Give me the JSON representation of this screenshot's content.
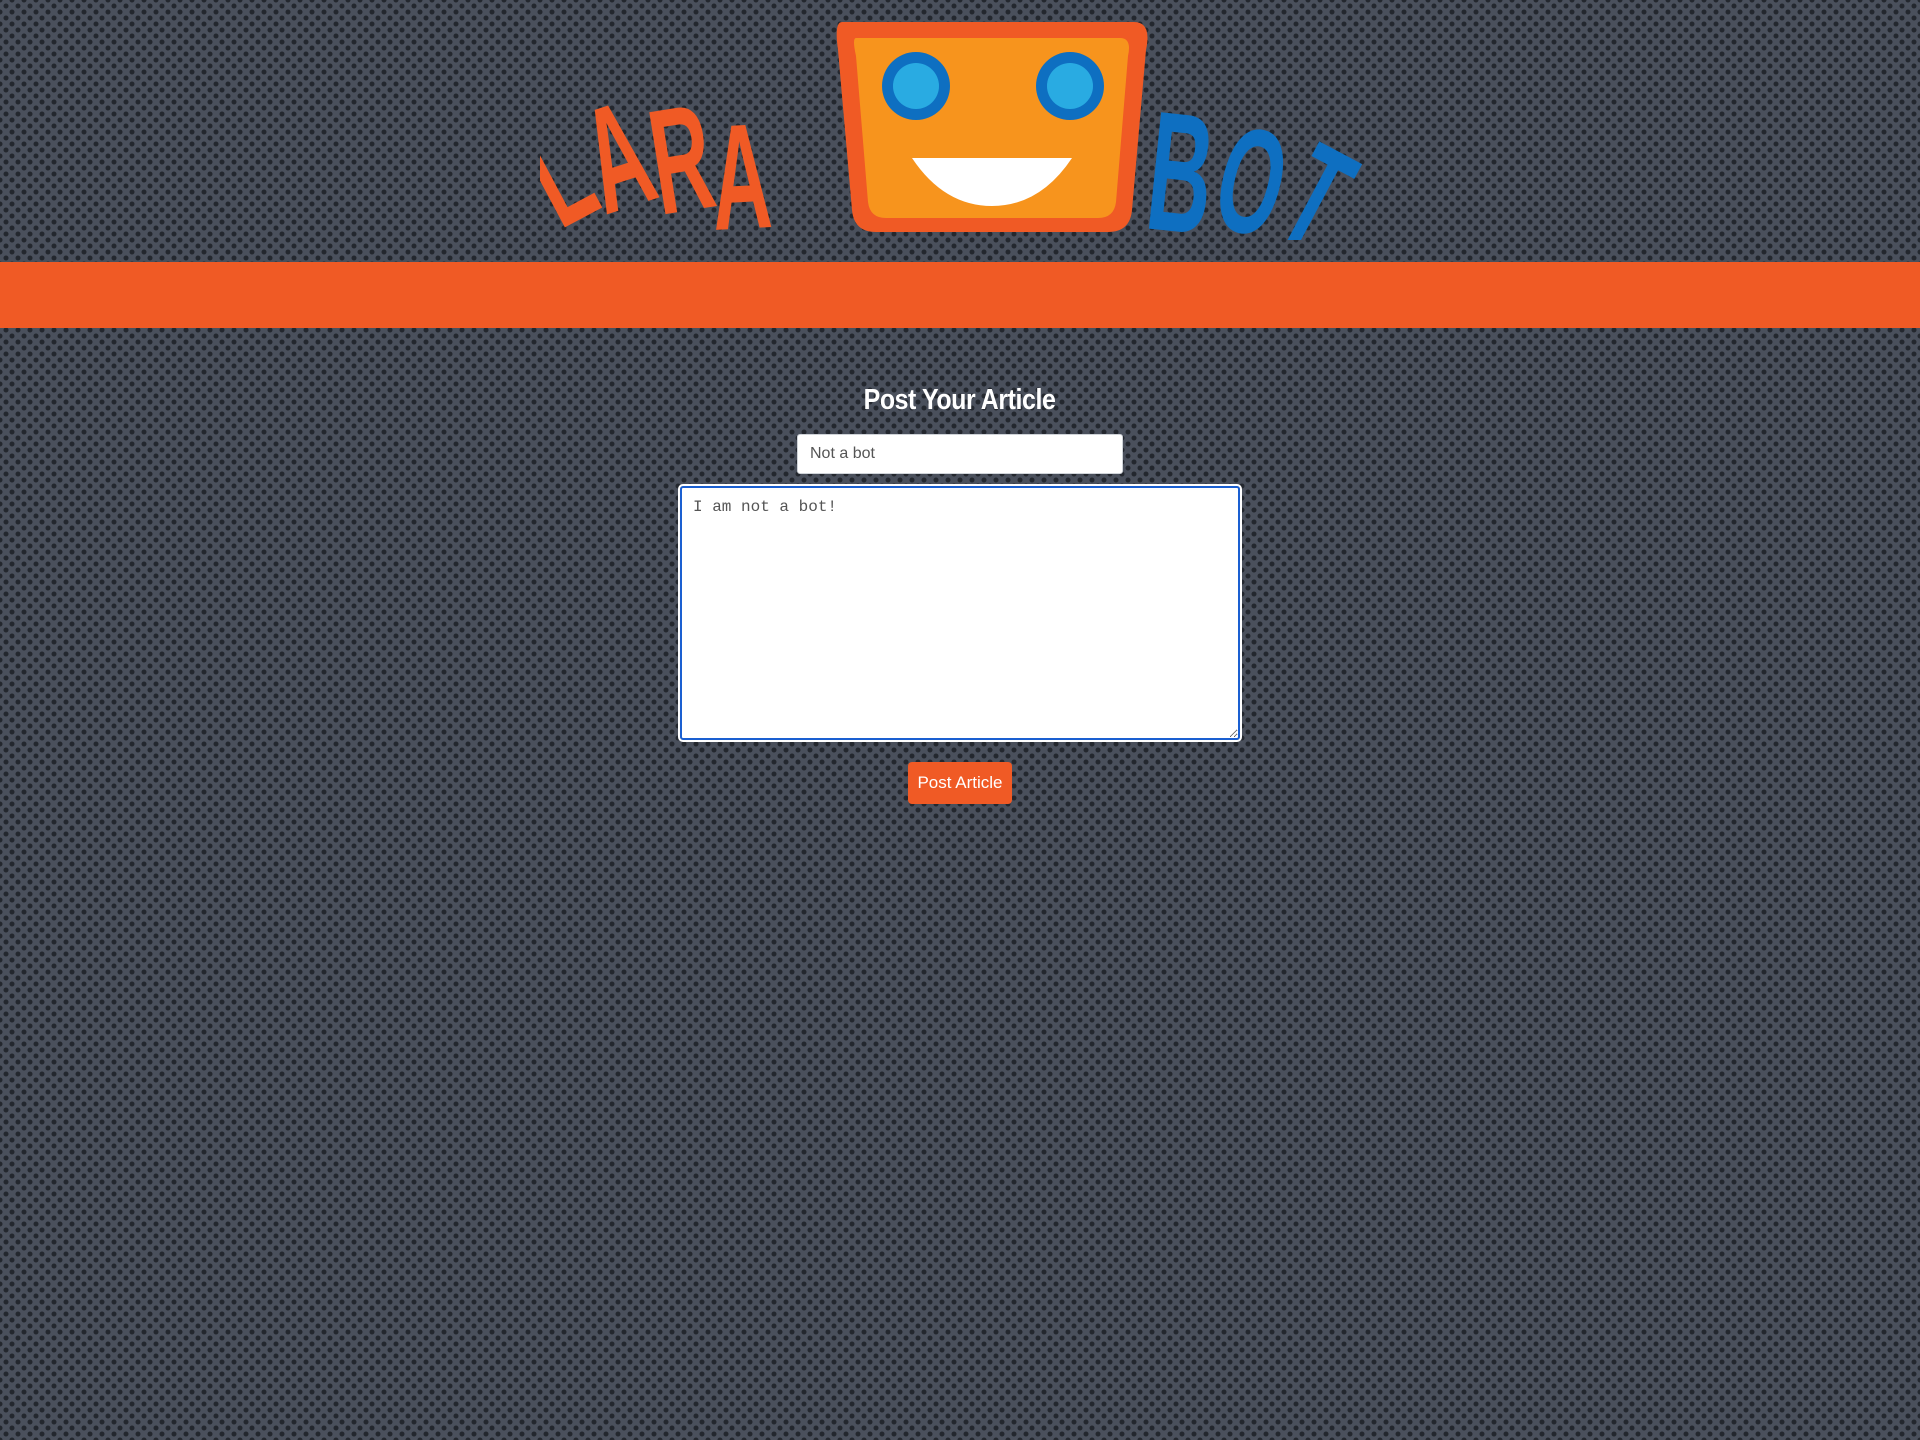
{
  "logo": {
    "left_text": "LARA",
    "right_text": "BOT",
    "colors": {
      "orange": "#f05a25",
      "face": "#f7941d",
      "blue": "#0e6fc1",
      "eye": "#29abe2"
    }
  },
  "banner": {
    "color": "#f05a25"
  },
  "form": {
    "title": "Post Your Article",
    "title_value": "Not a bot",
    "body_value": "I am not a bot!",
    "submit_label": "Post Article"
  }
}
